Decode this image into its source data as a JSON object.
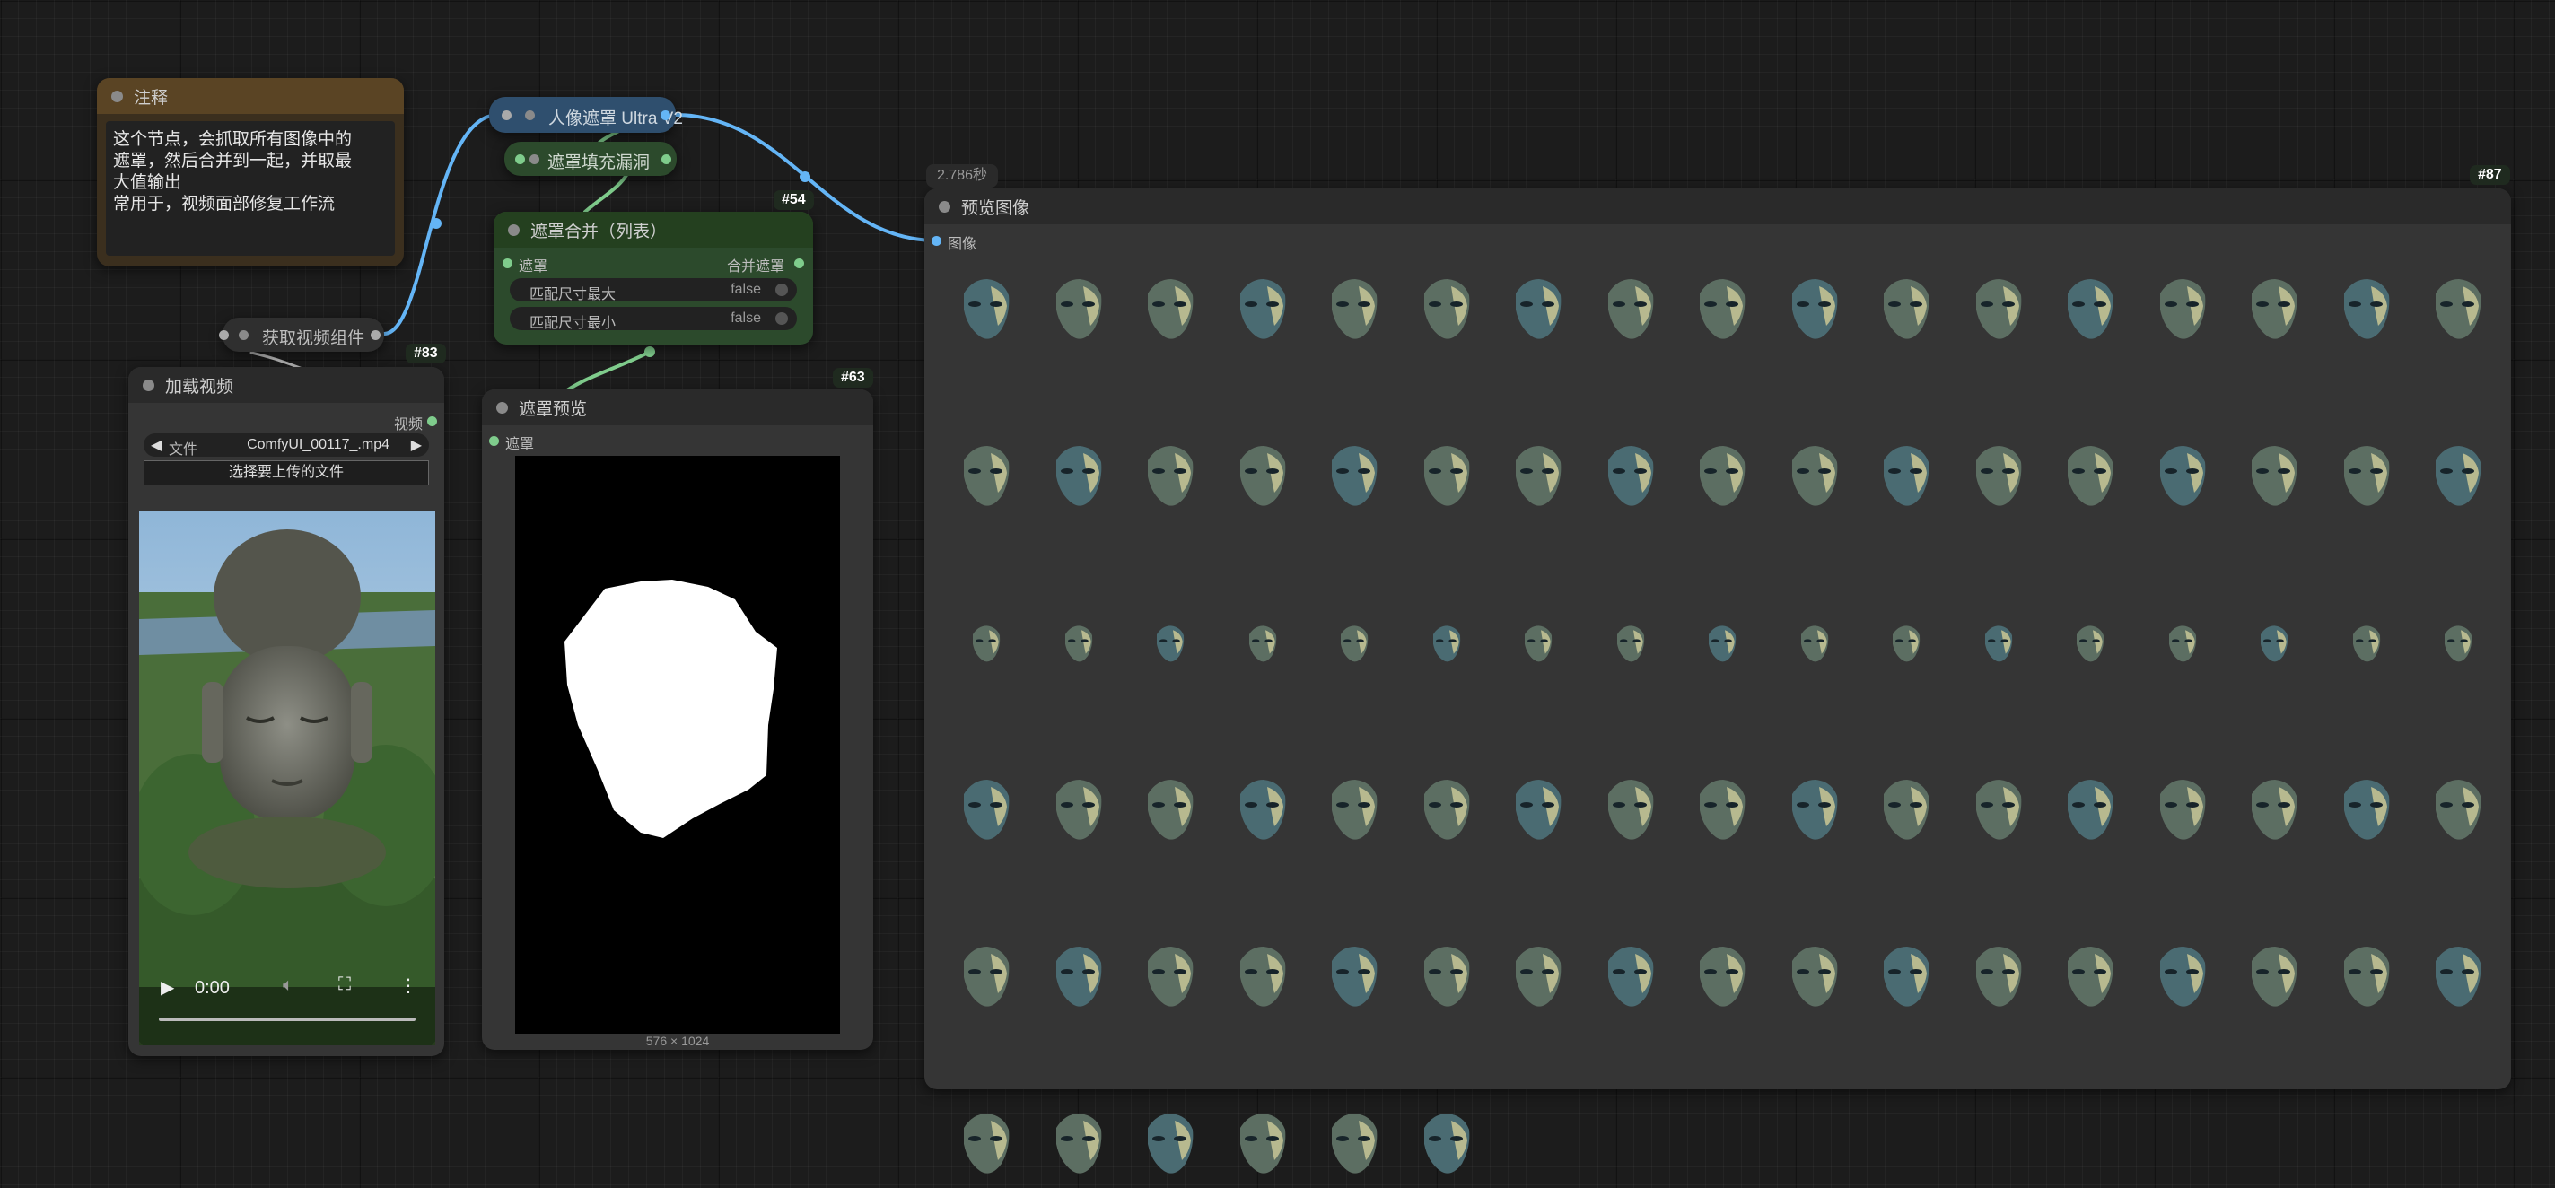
{
  "colors": {
    "canvas": "#1c1c1c",
    "node_body": "#353535",
    "note_header": "#5a4424",
    "note_body": "#3b2f1e",
    "blue_node": "#2f4f6e",
    "green_node": "#2c4a2c",
    "wire_blue": "#64b5f6",
    "wire_green": "#7fcc8c"
  },
  "timer": "2.786秒",
  "note": {
    "title": "注释",
    "lines": [
      "这个节点，会抓取所有图像中的",
      "遮罩，然后合并到一起，并取最",
      "大值输出",
      "常用于，视频面部修复工作流"
    ]
  },
  "portrait_mask": {
    "title": "人像遮罩 Ultra V2"
  },
  "fill_holes": {
    "title": "遮罩填充漏洞"
  },
  "merge": {
    "id": "#54",
    "title": "遮罩合并（列表）",
    "input": "遮罩",
    "output": "合并遮罩",
    "widgets": [
      {
        "label": "匹配尺寸最大",
        "value": "false"
      },
      {
        "label": "匹配尺寸最小",
        "value": "false"
      }
    ]
  },
  "get_video": {
    "title": "获取视频组件",
    "id": "#83"
  },
  "load_video": {
    "title": "加载视频",
    "output": "视频",
    "file_label": "文件",
    "file_value": "ComfyUI_00117_.mp4",
    "upload_label": "选择要上传的文件",
    "time": "0:00",
    "progress": 0
  },
  "mask_preview": {
    "id": "#63",
    "title": "遮罩预览",
    "input": "遮罩",
    "dims": "576 × 1024"
  },
  "preview_image": {
    "id": "#87",
    "title": "预览图像",
    "input": "图像",
    "thumb_count": 91,
    "columns": 17
  },
  "icons": [
    "play-icon",
    "volume-icon",
    "fullscreen-icon",
    "more-vertical-icon",
    "arrow-left-icon",
    "arrow-right-icon"
  ]
}
